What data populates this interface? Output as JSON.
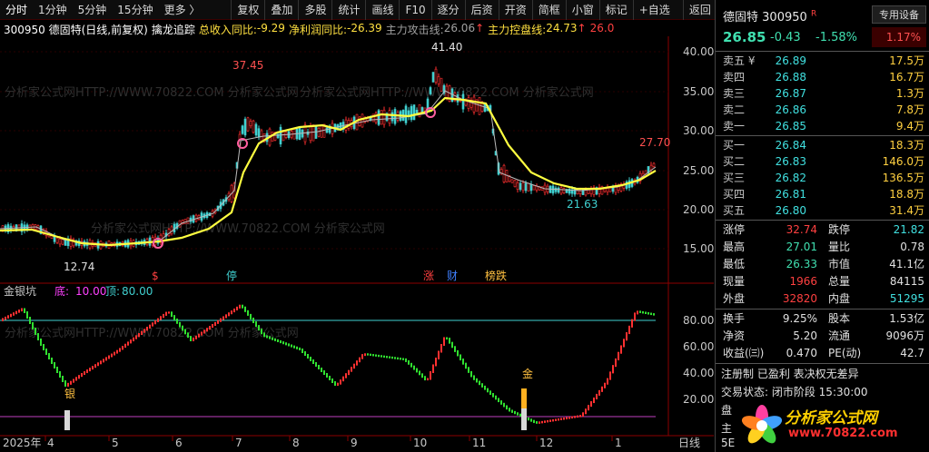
{
  "toolbar": {
    "items": [
      "分时",
      "1分钟",
      "5分钟",
      "15分钟",
      "更多 〉",
      "复权",
      "叠加",
      "多股",
      "统计",
      "画线",
      "F10",
      "逐分",
      "后资",
      "开资",
      "简框",
      "小窗",
      "标记",
      "+自选",
      "返回"
    ]
  },
  "chart_header": {
    "code_name": "300950 德固特(日线,前复权)",
    "indicator": "擒龙追踪",
    "income_label": "总收入同比:",
    "income_value": "-9.29",
    "profit_label": "净利润同比:",
    "profit_value": "-26.39",
    "attack_label": "主力攻击线:",
    "attack_value": "26.06",
    "control_label": "主力控盘线:",
    "control_value": "24.73",
    "extra_value": "26.0"
  },
  "price_axis": [
    "40.00",
    "35.00",
    "30.00",
    "25.00",
    "20.00",
    "15.00"
  ],
  "price_annotations": {
    "high": "41.40",
    "low": "12.74",
    "peak1": "37.45",
    "last": "27.70",
    "trough": "21.63"
  },
  "event_markers": {
    "m1": "$",
    "m2": "停",
    "m3": "涨",
    "m4": "财",
    "m5": "榜跌"
  },
  "lower_header": {
    "name": "金银坑",
    "bottom_label": "底:",
    "bottom_value": "10.00",
    "top_label": "顶:",
    "top_value": "80.00"
  },
  "lower_axis": [
    "80.00",
    "60.00",
    "40.00",
    "20.00"
  ],
  "lower_annotations": {
    "silver": "银",
    "gold": "金"
  },
  "x_axis": [
    "2025年",
    "4",
    "5",
    "6",
    "7",
    "8",
    "9",
    "10",
    "11",
    "12",
    "1",
    "日线"
  ],
  "watermark": "分析家公式网HTTP://WWW.70822.COM 分析家公式网",
  "logo": {
    "text": "分析家公式网",
    "url": "www.70822.com"
  },
  "quote": {
    "name": "德固特",
    "code": "300950",
    "flag": "R",
    "button": "专用设备",
    "price": "26.85",
    "change": "-0.43",
    "change_pct": "-1.58%",
    "sector_pct": "1.17%",
    "asks": [
      {
        "label": "卖五 ¥",
        "price": "26.89",
        "vol": "17.5万"
      },
      {
        "label": "卖四",
        "price": "26.88",
        "vol": "16.7万"
      },
      {
        "label": "卖三",
        "price": "26.87",
        "vol": "1.3万"
      },
      {
        "label": "卖二",
        "price": "26.86",
        "vol": "7.8万"
      },
      {
        "label": "卖一",
        "price": "26.85",
        "vol": "9.4万"
      }
    ],
    "bids": [
      {
        "label": "买一",
        "price": "26.84",
        "vol": "18.3万"
      },
      {
        "label": "买二",
        "price": "26.83",
        "vol": "146.0万"
      },
      {
        "label": "买三",
        "price": "26.82",
        "vol": "136.5万"
      },
      {
        "label": "买四",
        "price": "26.81",
        "vol": "18.8万"
      },
      {
        "label": "买五",
        "price": "26.80",
        "vol": "31.4万"
      }
    ],
    "stats1": [
      {
        "l1": "涨停",
        "v1": "32.74",
        "l2": "跌停",
        "v2": "21.82"
      },
      {
        "l1": "最高",
        "v1": "27.01",
        "l2": "量比",
        "v2": "0.78"
      },
      {
        "l1": "最低",
        "v1": "26.33",
        "l2": "市值",
        "v2": "41.1亿"
      },
      {
        "l1": "现量",
        "v1": "1966",
        "l2": "总量",
        "v2": "84115"
      },
      {
        "l1": "外盘",
        "v1": "32820",
        "l2": "内盘",
        "v2": "51295"
      }
    ],
    "stats2": [
      {
        "l1": "换手",
        "v1": "9.25%",
        "l2": "股本",
        "v2": "1.53亿"
      },
      {
        "l1": "净资",
        "v1": "5.20",
        "l2": "流通",
        "v2": "9096万"
      },
      {
        "l1": "收益(㈢)",
        "v1": "0.470",
        "l2": "PE(动)",
        "v2": "42.7"
      }
    ],
    "reg_line": "注册制 已盈利 表决权无差异",
    "trade_status": "交易状态: 闭市阶段 15:30:00",
    "pan_label": "盘",
    "main_label": "主",
    "five_label": "5E"
  }
}
